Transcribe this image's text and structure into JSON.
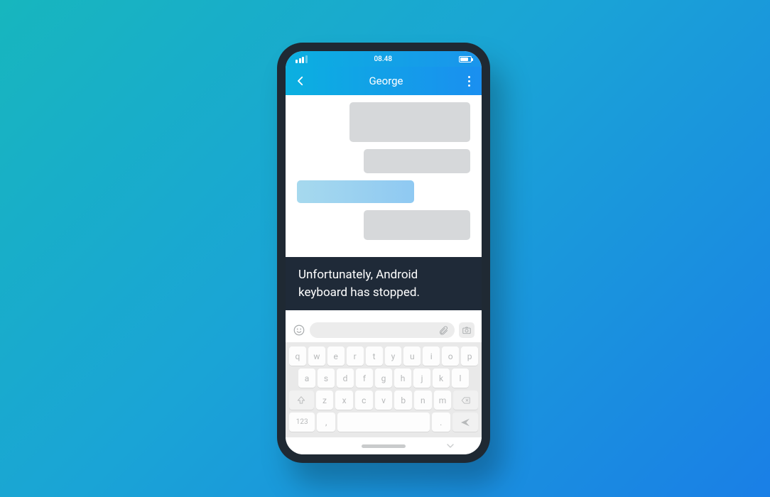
{
  "status": {
    "time": "08.48"
  },
  "chat": {
    "contact": "George"
  },
  "toast": {
    "line1": "Unfortunately, Android",
    "line2": "keyboard has stopped."
  },
  "kb": {
    "r1": [
      "q",
      "w",
      "e",
      "r",
      "t",
      "y",
      "u",
      "i",
      "o",
      "p"
    ],
    "r2": [
      "a",
      "s",
      "d",
      "f",
      "g",
      "h",
      "j",
      "k",
      "l"
    ],
    "r3": [
      "z",
      "x",
      "c",
      "v",
      "b",
      "n",
      "m"
    ],
    "numLabel": "123",
    "comma": ",",
    "period": "."
  }
}
